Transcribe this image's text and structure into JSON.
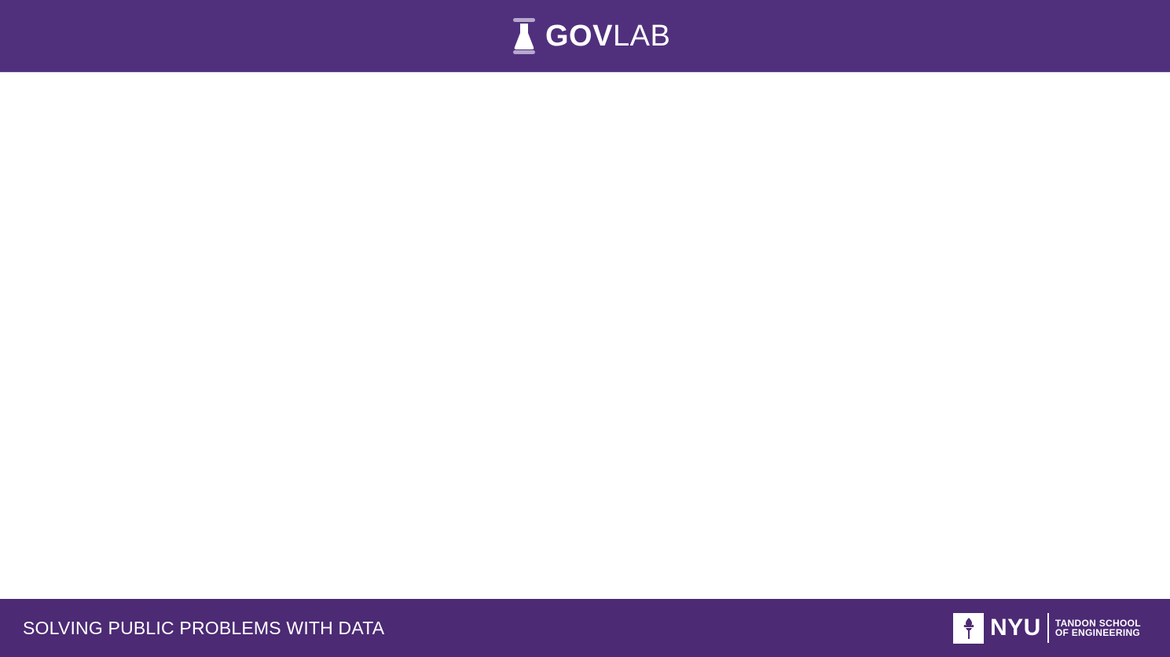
{
  "header": {
    "brand_bold": "GOV",
    "brand_light": "LAB",
    "logo_icon": "flask-icon",
    "background_color": "#50307d"
  },
  "footer": {
    "tagline": "SOLVING PUBLIC PROBLEMS WITH DATA",
    "partner_logo_icon": "torch-icon",
    "partner_name": "NYU",
    "school_line1": "TANDON SCHOOL",
    "school_line2": "OF ENGINEERING",
    "background_color": "#4c2a74"
  }
}
